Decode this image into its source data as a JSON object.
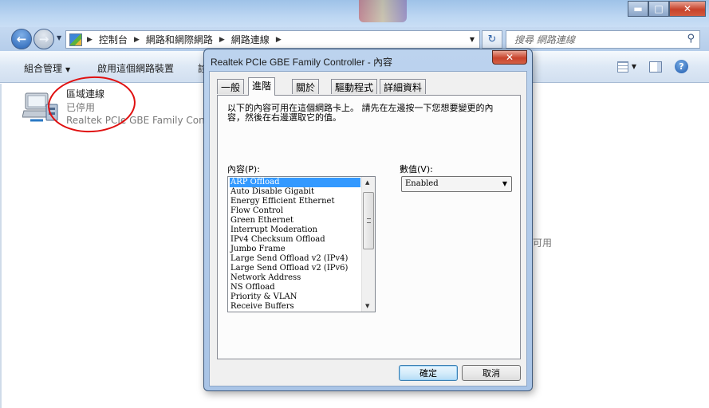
{
  "explorer": {
    "breadcrumb": [
      "控制台",
      "網路和網際網路",
      "網路連線"
    ],
    "search_placeholder": "搜尋 網路連線",
    "toolbar": {
      "organize_label": "組合管理",
      "enable_device_label": "啟用這個網路裝置",
      "truncated_label": "診"
    },
    "adapter": {
      "name": "區域連線",
      "status": "已停用",
      "device": "Realtek PCIe GBE Family Controller"
    },
    "background_fragment": "可用"
  },
  "dialog": {
    "title": "Realtek PCIe GBE Family Controller - 內容",
    "tabs": [
      "一般",
      "進階",
      "關於",
      "驅動程式",
      "詳細資料"
    ],
    "active_tab": "進階",
    "description": "以下的內容可用在這個網路卡上。 請先在左邊按一下您想要變更的內容，然後在右邊選取它的值。",
    "property_label": "內容(P):",
    "value_label": "數值(V):",
    "properties": [
      "ARP Offload",
      "Auto Disable Gigabit",
      "Energy Efficient Ethernet",
      "Flow Control",
      "Green Ethernet",
      "Interrupt Moderation",
      "IPv4 Checksum Offload",
      "Jumbo Frame",
      "Large Send Offload v2 (IPv4)",
      "Large Send Offload v2 (IPv6)",
      "Network Address",
      "NS Offload",
      "Priority & VLAN",
      "Receive Buffers"
    ],
    "selected_property": "ARP Offload",
    "value": "Enabled",
    "ok_label": "確定",
    "cancel_label": "取消"
  },
  "icons": {
    "back": "back-arrow-icon",
    "forward": "forward-arrow-icon",
    "refresh": "refresh-icon",
    "search": "search-icon",
    "help": "help-icon",
    "adapter": "network-adapter-icon"
  },
  "colors": {
    "selection": "#3399ff",
    "annotation_circle": "#e01010",
    "dialog_frame": "#a9c4e6",
    "close_button": "#c8442d"
  }
}
